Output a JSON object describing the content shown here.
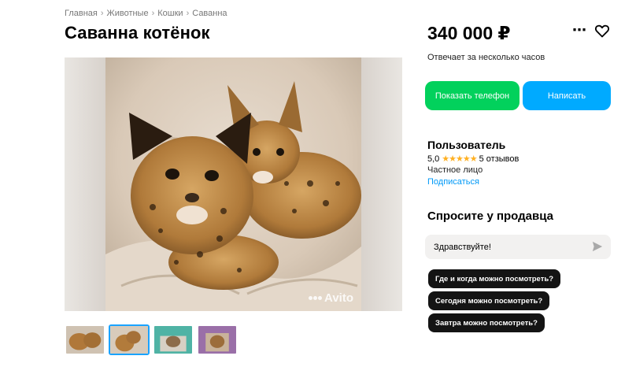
{
  "breadcrumb": [
    "Главная",
    "Животные",
    "Кошки",
    "Саванна"
  ],
  "breadcrumb_sep": "›",
  "title": "Саванна котёнок",
  "price": "340 000 ₽",
  "more_icon": "⋯",
  "response_time": "Отвечает за несколько часов",
  "buttons": {
    "phone": "Показать телефон",
    "write": "Написать"
  },
  "seller": {
    "name": "Пользователь",
    "rating": "5,0",
    "stars": "★★★★★",
    "reviews": "5 отзывов",
    "type": "Частное лицо",
    "subscribe": "Подписаться"
  },
  "ask": {
    "title": "Спросите у продавца",
    "input_value": "Здравствуйте!",
    "chips": [
      "Где и когда можно посмотреть?",
      "Сегодня можно посмотреть?",
      "Завтра можно посмотреть?"
    ]
  },
  "watermark": "Avito",
  "colors": {
    "phone_button": "#02d15c",
    "write_button": "#00aaff",
    "link": "#0099f7",
    "stars": "#ffb021",
    "chip_bg": "#141414",
    "thumb_active": "#1aa3ff"
  },
  "icons": [
    "more-icon",
    "heart-icon",
    "send-icon"
  ]
}
